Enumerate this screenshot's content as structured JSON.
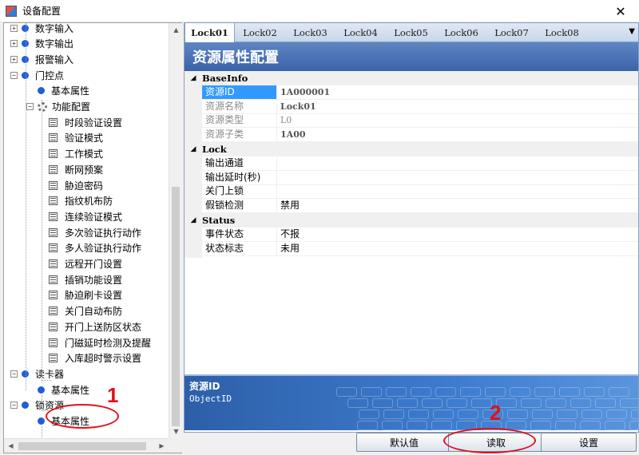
{
  "window": {
    "title": "设备配置"
  },
  "tree": {
    "items": [
      {
        "label": "数字输入",
        "kind": "dot",
        "expander": "+"
      },
      {
        "label": "数字输出",
        "kind": "dot",
        "expander": "+"
      },
      {
        "label": "报警输入",
        "kind": "dot",
        "expander": "+"
      },
      {
        "label": "门控点",
        "kind": "dot",
        "expander": "-"
      },
      {
        "label": "基本属性",
        "kind": "dot"
      },
      {
        "label": "功能配置",
        "kind": "gear",
        "expander": "-"
      },
      {
        "label": "时段验证设置",
        "kind": "leaf"
      },
      {
        "label": "验证模式",
        "kind": "leaf"
      },
      {
        "label": "工作模式",
        "kind": "leaf"
      },
      {
        "label": "断网预案",
        "kind": "leaf"
      },
      {
        "label": "胁迫密码",
        "kind": "leaf"
      },
      {
        "label": "指纹机布防",
        "kind": "leaf"
      },
      {
        "label": "连续验证模式",
        "kind": "leaf"
      },
      {
        "label": "多次验证执行动作",
        "kind": "leaf"
      },
      {
        "label": "多人验证执行动作",
        "kind": "leaf"
      },
      {
        "label": "远程开门设置",
        "kind": "leaf"
      },
      {
        "label": "插销功能设置",
        "kind": "leaf"
      },
      {
        "label": "胁迫刷卡设置",
        "kind": "leaf"
      },
      {
        "label": "关门自动布防",
        "kind": "leaf"
      },
      {
        "label": "开门上送防区状态",
        "kind": "leaf"
      },
      {
        "label": "门磁延时检测及提醒",
        "kind": "leaf"
      },
      {
        "label": "入库超时警示设置",
        "kind": "leaf"
      },
      {
        "label": "读卡器",
        "kind": "dot",
        "expander": "-"
      },
      {
        "label": "基本属性",
        "kind": "dot"
      },
      {
        "label": "锁资源",
        "kind": "dot",
        "expander": "-"
      },
      {
        "label": "基本属性",
        "kind": "dot"
      }
    ]
  },
  "tabs": [
    "Lock01",
    "Lock02",
    "Lock03",
    "Lock04",
    "Lock05",
    "Lock06",
    "Lock07",
    "Lock08"
  ],
  "active_tab": "Lock01",
  "panel_header": "资源属性配置",
  "property_grid": {
    "categories": [
      {
        "name": "BaseInfo",
        "props": [
          {
            "name": "资源ID",
            "value": "1A000001"
          },
          {
            "name": "资源名称",
            "value": "Lock01"
          },
          {
            "name": "资源类型",
            "value": "L0"
          },
          {
            "name": "资源子类",
            "value": "1A00"
          }
        ]
      },
      {
        "name": "Lock",
        "props": [
          {
            "name": "输出通道",
            "value": ""
          },
          {
            "name": "输出延时(秒)",
            "value": ""
          },
          {
            "name": "关门上锁",
            "value": ""
          },
          {
            "name": "假锁检测",
            "value": "禁用"
          }
        ]
      },
      {
        "name": "Status",
        "props": [
          {
            "name": "事件状态",
            "value": "不报"
          },
          {
            "name": "状态标志",
            "value": "未用"
          }
        ]
      }
    ]
  },
  "description": {
    "title": "资源ID",
    "text": "ObjectID"
  },
  "buttons": {
    "default": "默认值",
    "read": "读取",
    "set": "设置"
  },
  "annotations": {
    "one": "1",
    "two": "2"
  },
  "colors": {
    "annotation": "#e0111a",
    "header": "#4a72b8",
    "selection": "#3399ff",
    "tree_dot": "#1f5ed8"
  }
}
